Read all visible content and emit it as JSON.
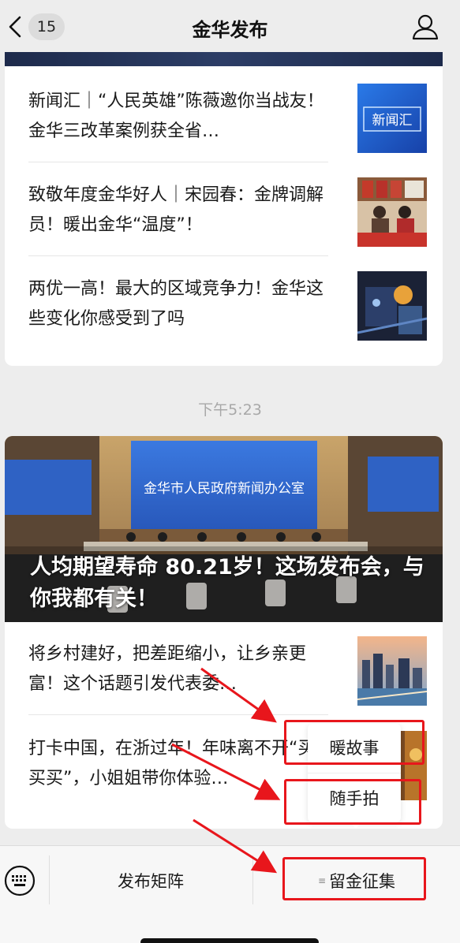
{
  "nav": {
    "unread_count": "15",
    "title": "金华发布"
  },
  "articles_top": [
    {
      "title": "新闻汇｜“人民英雄”陈薇邀你当战友！ 金华三改革案例获全省…",
      "thumb_text": "新闻汇"
    },
    {
      "title": "致敬年度金华好人｜宋园春：金牌调解员！暖出金华“温度”！"
    },
    {
      "title": "两优一高！最大的区域竞争力！金华这些变化你感受到了吗"
    }
  ],
  "timestamp": "下午5:23",
  "hero": {
    "title": "人均期望寿命 80.21岁！这场发布会，与你我都有关！",
    "screen_text": "金华市人民政府新闻办公室"
  },
  "articles_bottom": [
    {
      "title": "将乡村建好，把差距缩小，让乡亲更富！这个话题引发代表委…"
    },
    {
      "title": "打卡中国，在浙过年！年味离不开“买买买”，小姐姐带你体验…"
    }
  ],
  "popup_menu": {
    "items": [
      "暖故事",
      "随手拍"
    ]
  },
  "bottom_menu": {
    "items": [
      "发布矩阵",
      "留金征集"
    ]
  },
  "colors": {
    "annotation_red": "#e8161c",
    "background": "#ededed"
  }
}
